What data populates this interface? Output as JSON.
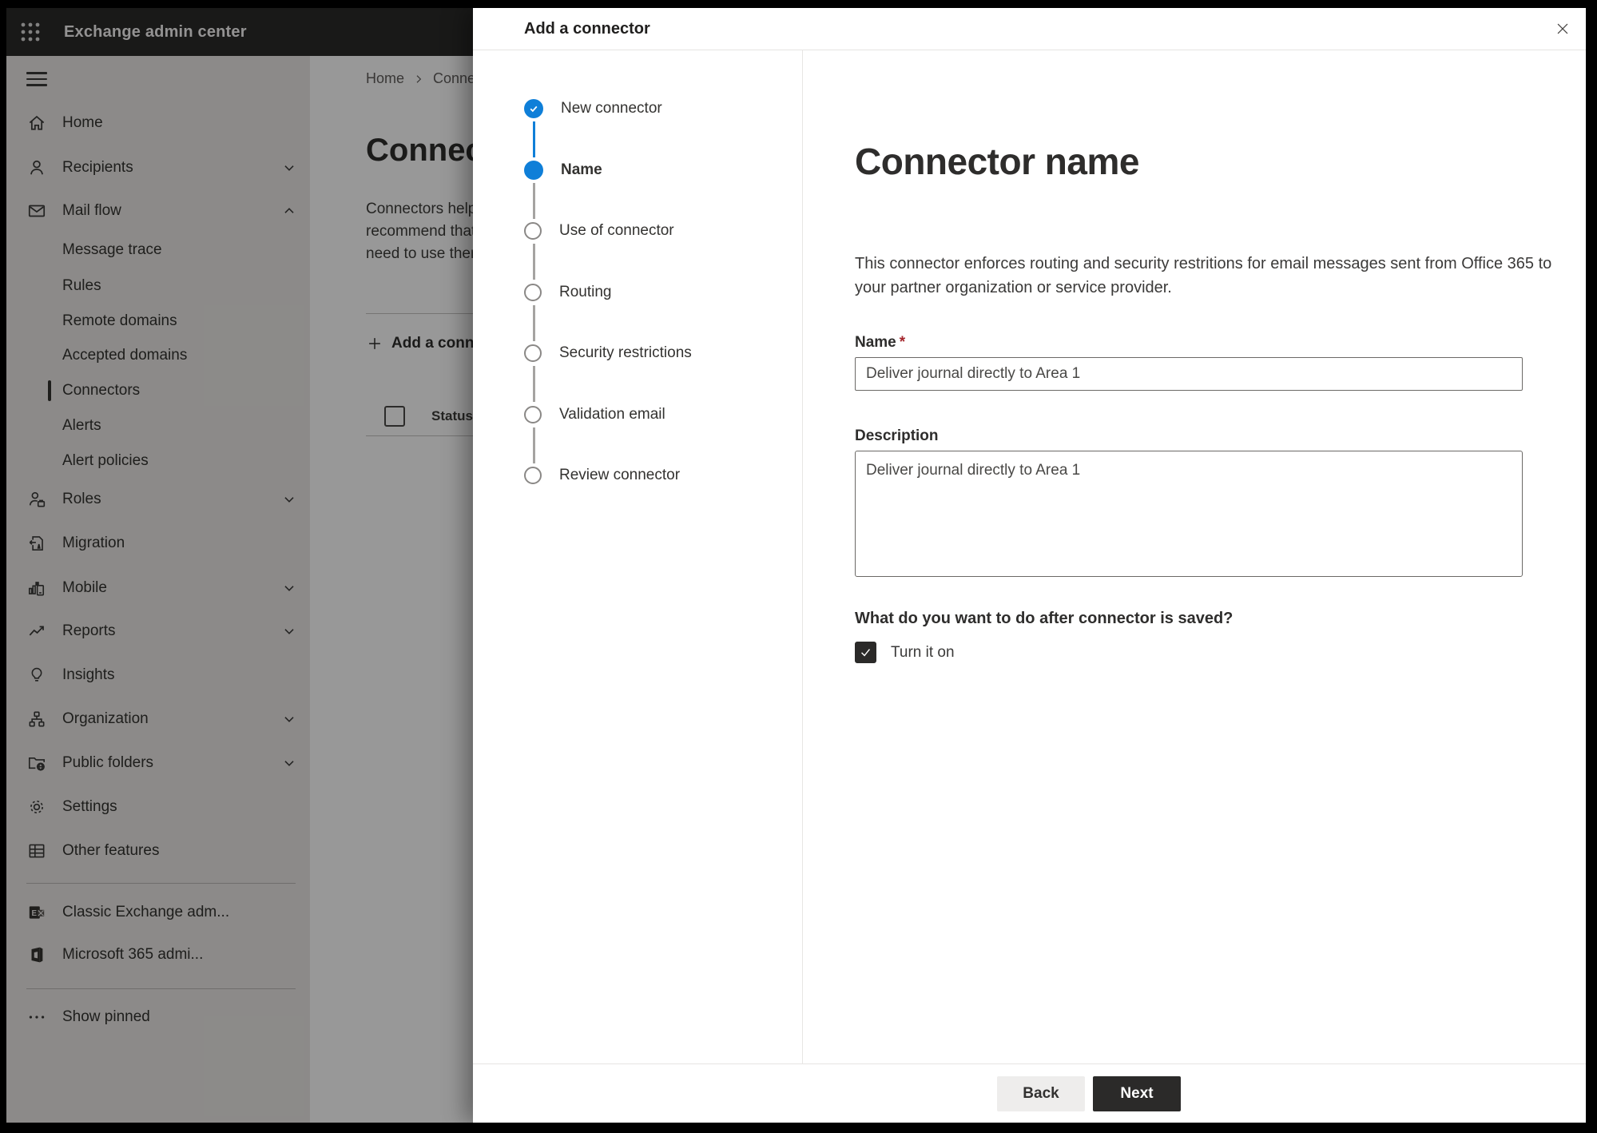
{
  "header": {
    "app_title": "Exchange admin center"
  },
  "sidebar": {
    "items": [
      {
        "label": "Home"
      },
      {
        "label": "Recipients"
      },
      {
        "label": "Mail flow"
      },
      {
        "label": "Message trace"
      },
      {
        "label": "Rules"
      },
      {
        "label": "Remote domains"
      },
      {
        "label": "Accepted domains"
      },
      {
        "label": "Connectors"
      },
      {
        "label": "Alerts"
      },
      {
        "label": "Alert policies"
      },
      {
        "label": "Roles"
      },
      {
        "label": "Migration"
      },
      {
        "label": "Mobile"
      },
      {
        "label": "Reports"
      },
      {
        "label": "Insights"
      },
      {
        "label": "Organization"
      },
      {
        "label": "Public folders"
      },
      {
        "label": "Settings"
      },
      {
        "label": "Other features"
      },
      {
        "label": "Classic Exchange adm..."
      },
      {
        "label": "Microsoft 365 admi..."
      },
      {
        "label": "Show pinned"
      }
    ]
  },
  "background_page": {
    "breadcrumb": {
      "home": "Home",
      "current": "Connectors"
    },
    "title": "Connectors",
    "intro_lines": {
      "line1": "Connectors help",
      "line2": "recommend that",
      "line3": "need to use ther"
    },
    "add_button_label": "Add a connector",
    "table": {
      "status_header": "Status"
    }
  },
  "dialog": {
    "title": "Add a connector",
    "steps": [
      {
        "label": "New connector",
        "state": "completed"
      },
      {
        "label": "Name",
        "state": "current"
      },
      {
        "label": "Use of connector",
        "state": "upcoming"
      },
      {
        "label": "Routing",
        "state": "upcoming"
      },
      {
        "label": "Security restrictions",
        "state": "upcoming"
      },
      {
        "label": "Validation email",
        "state": "upcoming"
      },
      {
        "label": "Review connector",
        "state": "upcoming"
      }
    ],
    "content": {
      "heading": "Connector name",
      "description": "This connector enforces routing and security restritions for email messages sent from Office 365 to your partner organization or service provider.",
      "name_label": "Name",
      "required_marker": "*",
      "name_value": "Deliver journal directly to Area 1",
      "description_label": "Description",
      "description_value": "Deliver journal directly to Area 1",
      "after_save_question": "What do you want to do after connector is saved?",
      "turn_on_label": "Turn it on",
      "turn_on_checked": true
    },
    "footer": {
      "back_label": "Back",
      "next_label": "Next"
    }
  },
  "colors": {
    "accent_blue": "#0f7fd8",
    "required_red": "#a4262c",
    "primary_button_bg": "#2b2a29",
    "checkbox_bg": "#2b2a29"
  }
}
